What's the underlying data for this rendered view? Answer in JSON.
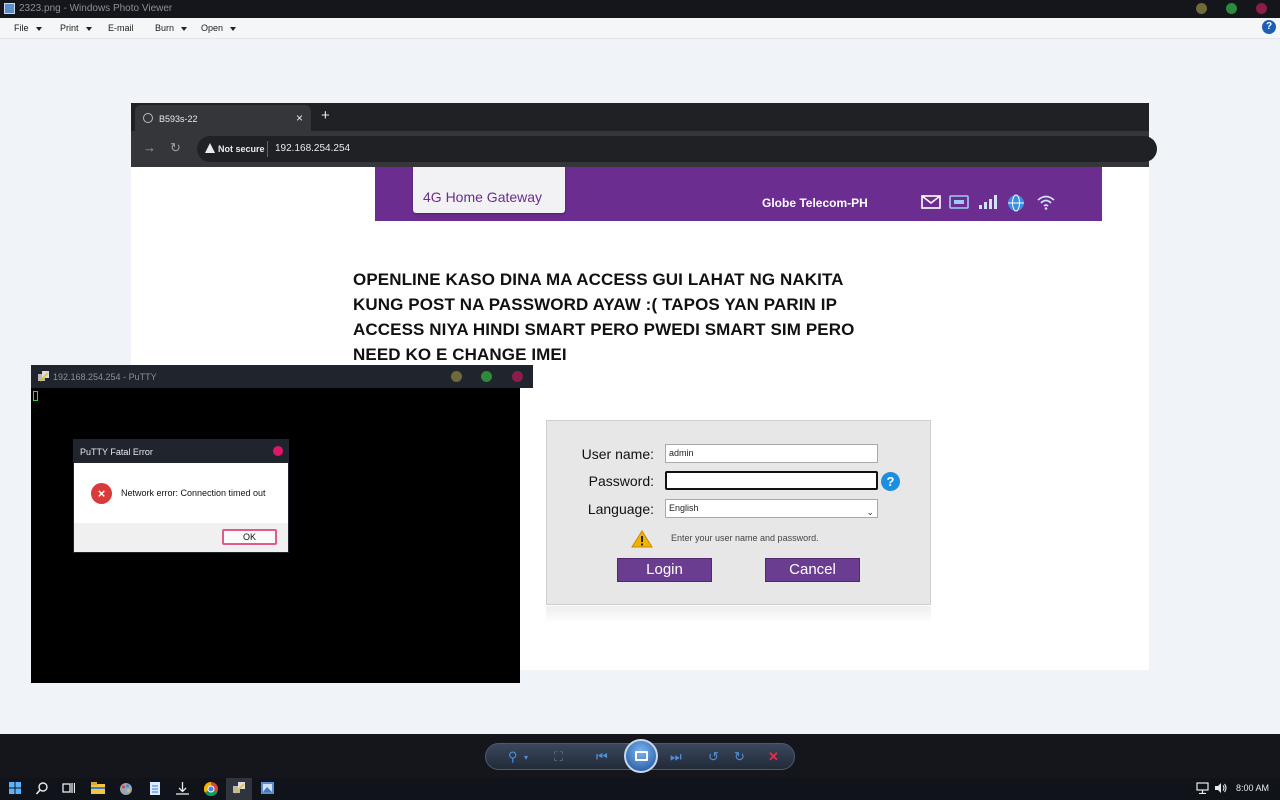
{
  "photo_viewer": {
    "title": "2323.png - Windows Photo Viewer",
    "menu": {
      "file": "File",
      "print": "Print",
      "email": "E-mail",
      "burn": "Burn",
      "open": "Open"
    },
    "help": "?"
  },
  "browser": {
    "tab_title": "B593s-22",
    "tab_close": "×",
    "new_tab": "+",
    "not_secure": "Not secure",
    "url": "192.168.254.254"
  },
  "router": {
    "gateway_title": "4G Home Gateway",
    "operator": "Globe Telecom-PH"
  },
  "overlay_text": "OPENLINE KASO DINA MA ACCESS GUI LAHAT NG NAKITA KUNG POST NA PASSWORD AYAW :( TAPOS YAN PARIN IP ACCESS NIYA HINDI SMART PERO PWEDI SMART SIM PERO NEED KO E CHANGE IMEI",
  "login": {
    "username_label": "User name:",
    "username_value": "admin",
    "password_label": "Password:",
    "password_value": "",
    "language_label": "Language:",
    "language_value": "English",
    "help_icon": "?",
    "message": "Enter your user name and password.",
    "login_button": "Login",
    "cancel_button": "Cancel"
  },
  "putty": {
    "title": "192.168.254.254 - PuTTY"
  },
  "error_dialog": {
    "title": "PuTTY Fatal Error",
    "icon": "×",
    "message": "Network error: Connection timed out",
    "ok_button": "OK"
  },
  "taskbar": {
    "clock": "8:00 AM"
  },
  "colors": {
    "router_purple": "#6b2d8f",
    "button_purple": "#6b3d91",
    "error_red": "#d93a3a"
  }
}
